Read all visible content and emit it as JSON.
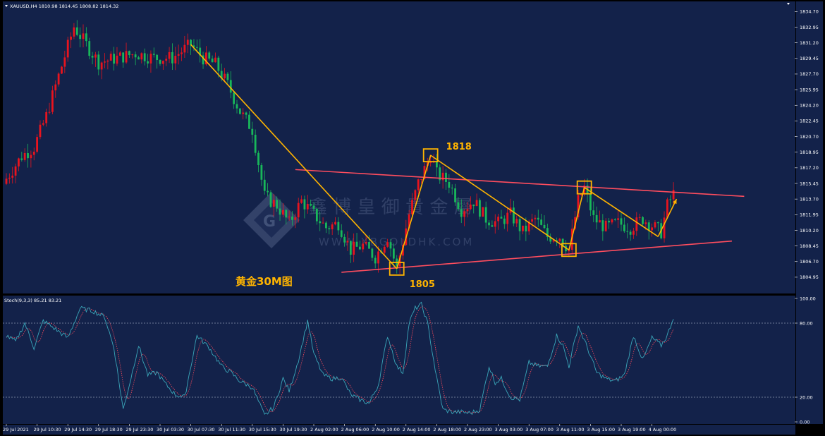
{
  "header": {
    "main_label": "XAUUSD,H4  1810.98 1814.45 1808.82 1814.32",
    "osc_label": "Stoch(9,3,3) 85.21 83.21"
  },
  "title": "黄金30M图",
  "watermark": {
    "text_cn": "鑫 博 皇 御 貴 金 屬",
    "text_en": "WWW.XBGOLDHK.COM"
  },
  "colors": {
    "background": "#13224a",
    "frame": "#000000",
    "bull": "#e8141e",
    "bear": "#18b75a",
    "trend": "#ffb400",
    "channel": "#ff4d5e",
    "stoch_main": "#3aa6b9",
    "stoch_signal": "#ff4d5e",
    "text": "#ffffff"
  },
  "chart_data": [
    {
      "type": "candlestick",
      "symbol": "XAUUSD",
      "ylim": [
        1803.6,
        1835.2
      ],
      "yticks": [
        "1834.70",
        "1832.95",
        "1831.20",
        "1829.45",
        "1827.70",
        "1825.95",
        "1824.20",
        "1822.45",
        "1820.70",
        "1818.95",
        "1817.20",
        "1815.45",
        "1813.70",
        "1811.95",
        "1810.20",
        "1808.45",
        "1806.70",
        "1804.95"
      ],
      "x_ticks": [
        {
          "i": 0,
          "label": "29 Jul 2021"
        },
        {
          "i": 10,
          "label": "29 Jul 10:30"
        },
        {
          "i": 20,
          "label": "29 Jul 14:30"
        },
        {
          "i": 30,
          "label": "29 Jul 18:30"
        },
        {
          "i": 40,
          "label": "29 Jul 23:30"
        },
        {
          "i": 50,
          "label": "30 Jul 03:30"
        },
        {
          "i": 60,
          "label": "30 Jul 07:30"
        },
        {
          "i": 70,
          "label": "30 Jul 11:30"
        },
        {
          "i": 80,
          "label": "30 Jul 15:30"
        },
        {
          "i": 90,
          "label": "30 Jul 19:30"
        },
        {
          "i": 100,
          "label": "2 Aug 02:00"
        },
        {
          "i": 110,
          "label": "2 Aug 06:00"
        },
        {
          "i": 120,
          "label": "2 Aug 10:00"
        },
        {
          "i": 130,
          "label": "2 Aug 14:00"
        },
        {
          "i": 140,
          "label": "2 Aug 18:00"
        },
        {
          "i": 150,
          "label": "2 Aug 23:00"
        },
        {
          "i": 160,
          "label": "3 Aug 03:00"
        },
        {
          "i": 170,
          "label": "3 Aug 07:00"
        },
        {
          "i": 180,
          "label": "3 Aug 11:00"
        },
        {
          "i": 190,
          "label": "3 Aug 15:00"
        },
        {
          "i": 200,
          "label": "3 Aug 19:00"
        },
        {
          "i": 210,
          "label": "4 Aug 00:00"
        }
      ],
      "anchors": [
        [
          0,
          1816.0
        ],
        [
          5,
          1818.5
        ],
        [
          9,
          1819.5
        ],
        [
          13,
          1823.0
        ],
        [
          17,
          1827.5
        ],
        [
          22,
          1833.0
        ],
        [
          26,
          1831.0
        ],
        [
          30,
          1829.0
        ],
        [
          36,
          1829.5
        ],
        [
          42,
          1830.0
        ],
        [
          48,
          1829.5
        ],
        [
          54,
          1829.5
        ],
        [
          60,
          1831.0
        ],
        [
          64,
          1829.5
        ],
        [
          68,
          1828.8
        ],
        [
          72,
          1826.5
        ],
        [
          76,
          1823.5
        ],
        [
          80,
          1821.5
        ],
        [
          84,
          1814.0
        ],
        [
          88,
          1813.0
        ],
        [
          92,
          1811.0
        ],
        [
          96,
          1813.5
        ],
        [
          100,
          1812.0
        ],
        [
          104,
          1810.5
        ],
        [
          108,
          1811.0
        ],
        [
          112,
          1808.0
        ],
        [
          116,
          1808.5
        ],
        [
          120,
          1807.2
        ],
        [
          124,
          1809.5
        ],
        [
          127,
          1805.9
        ],
        [
          131,
          1812.0
        ],
        [
          134,
          1815.5
        ],
        [
          138,
          1818.6
        ],
        [
          140,
          1816.5
        ],
        [
          144,
          1815.5
        ],
        [
          148,
          1812.5
        ],
        [
          152,
          1813.5
        ],
        [
          156,
          1811.5
        ],
        [
          160,
          1811.0
        ],
        [
          164,
          1812.0
        ],
        [
          168,
          1810.0
        ],
        [
          172,
          1811.5
        ],
        [
          176,
          1809.5
        ],
        [
          180,
          1809.5
        ],
        [
          183,
          1808.0
        ],
        [
          186,
          1813.5
        ],
        [
          188,
          1815.0
        ],
        [
          191,
          1811.5
        ],
        [
          195,
          1810.5
        ],
        [
          199,
          1811.0
        ],
        [
          203,
          1810.5
        ],
        [
          207,
          1811.5
        ],
        [
          211,
          1810.5
        ],
        [
          213,
          1810.0
        ],
        [
          215,
          1813.0
        ],
        [
          217,
          1814.3
        ]
      ],
      "annotations": [
        {
          "label": "1805",
          "i": 127,
          "price": 1805.9
        },
        {
          "label": "1818",
          "i": 138,
          "price": 1818.6
        },
        {
          "label": "",
          "i": 183,
          "price": 1808.0
        },
        {
          "label": "",
          "i": 188,
          "price": 1815.0
        }
      ],
      "trend_lines": [
        [
          [
            60,
            1831.0
          ],
          [
            127,
            1805.9
          ]
        ],
        [
          [
            127,
            1805.9
          ],
          [
            138,
            1818.6
          ]
        ],
        [
          [
            138,
            1818.6
          ],
          [
            183,
            1808.0
          ]
        ],
        [
          [
            183,
            1808.0
          ],
          [
            188,
            1815.0
          ]
        ],
        [
          [
            188,
            1815.0
          ],
          [
            212,
            1809.5
          ]
        ],
        [
          [
            212,
            1809.5
          ],
          [
            218,
            1813.7
          ]
        ]
      ],
      "channel_lines": [
        [
          [
            94,
            1817.0
          ],
          [
            240,
            1814.0
          ]
        ],
        [
          [
            109,
            1805.5
          ],
          [
            236,
            1809.0
          ]
        ]
      ]
    },
    {
      "type": "line",
      "name": "Stoch(9,3,3)",
      "ylim": [
        0,
        100
      ],
      "yticks": [
        "100.00",
        "80.00",
        "20.00",
        "0.00"
      ],
      "levels": [
        80,
        20
      ],
      "main_value": 85.21,
      "signal_value": 83.21,
      "anchors": [
        [
          0,
          70
        ],
        [
          3,
          65
        ],
        [
          6,
          80
        ],
        [
          9,
          60
        ],
        [
          12,
          82
        ],
        [
          16,
          75
        ],
        [
          20,
          68
        ],
        [
          24,
          92
        ],
        [
          28,
          90
        ],
        [
          32,
          85
        ],
        [
          35,
          60
        ],
        [
          38,
          10
        ],
        [
          40,
          30
        ],
        [
          43,
          62
        ],
        [
          46,
          38
        ],
        [
          49,
          40
        ],
        [
          52,
          30
        ],
        [
          55,
          22
        ],
        [
          58,
          20
        ],
        [
          62,
          70
        ],
        [
          66,
          60
        ],
        [
          70,
          45
        ],
        [
          73,
          40
        ],
        [
          76,
          33
        ],
        [
          80,
          28
        ],
        [
          84,
          5
        ],
        [
          87,
          12
        ],
        [
          90,
          35
        ],
        [
          92,
          25
        ],
        [
          95,
          50
        ],
        [
          98,
          82
        ],
        [
          100,
          55
        ],
        [
          103,
          38
        ],
        [
          106,
          35
        ],
        [
          109,
          36
        ],
        [
          112,
          22
        ],
        [
          115,
          18
        ],
        [
          118,
          15
        ],
        [
          121,
          30
        ],
        [
          124,
          70
        ],
        [
          127,
          45
        ],
        [
          129,
          40
        ],
        [
          131,
          80
        ],
        [
          133,
          92
        ],
        [
          135,
          95
        ],
        [
          137,
          80
        ],
        [
          140,
          35
        ],
        [
          142,
          10
        ],
        [
          145,
          8
        ],
        [
          148,
          8
        ],
        [
          151,
          7
        ],
        [
          154,
          10
        ],
        [
          157,
          45
        ],
        [
          159,
          32
        ],
        [
          161,
          35
        ],
        [
          164,
          20
        ],
        [
          167,
          18
        ],
        [
          170,
          48
        ],
        [
          173,
          45
        ],
        [
          176,
          45
        ],
        [
          179,
          70
        ],
        [
          181,
          62
        ],
        [
          183,
          45
        ],
        [
          186,
          78
        ],
        [
          189,
          60
        ],
        [
          192,
          40
        ],
        [
          195,
          35
        ],
        [
          198,
          33
        ],
        [
          201,
          38
        ],
        [
          204,
          70
        ],
        [
          207,
          50
        ],
        [
          210,
          68
        ],
        [
          213,
          62
        ],
        [
          215,
          70
        ],
        [
          217,
          85
        ]
      ]
    }
  ]
}
